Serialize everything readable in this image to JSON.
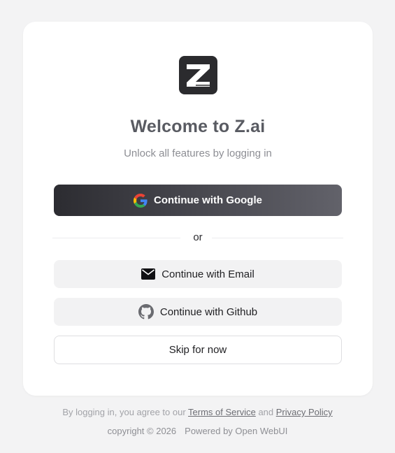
{
  "brand": {
    "logo_alt": "Z",
    "title": "Welcome to Z.ai",
    "subtitle": "Unlock all features by logging in"
  },
  "auth": {
    "google_label": "Continue with Google",
    "divider_text": "or",
    "email_label": "Continue with Email",
    "github_label": "Continue with Github",
    "skip_label": "Skip for now"
  },
  "footer": {
    "terms_prefix": "By logging in, you agree to our ",
    "terms_link": "Terms of Service",
    "terms_and": " and ",
    "privacy_link": "Privacy Policy",
    "copyright": "copyright © 2026",
    "powered_by": "Powered by Open WebUI"
  },
  "colors": {
    "background": "#f3f3f4",
    "card": "#ffffff",
    "google_button": "#3a3a40",
    "secondary_button": "#f2f2f3",
    "title": "#595b62"
  },
  "icons": {
    "logo": "z-logo-icon",
    "google": "google-icon",
    "email": "envelope-icon",
    "github": "github-icon"
  }
}
